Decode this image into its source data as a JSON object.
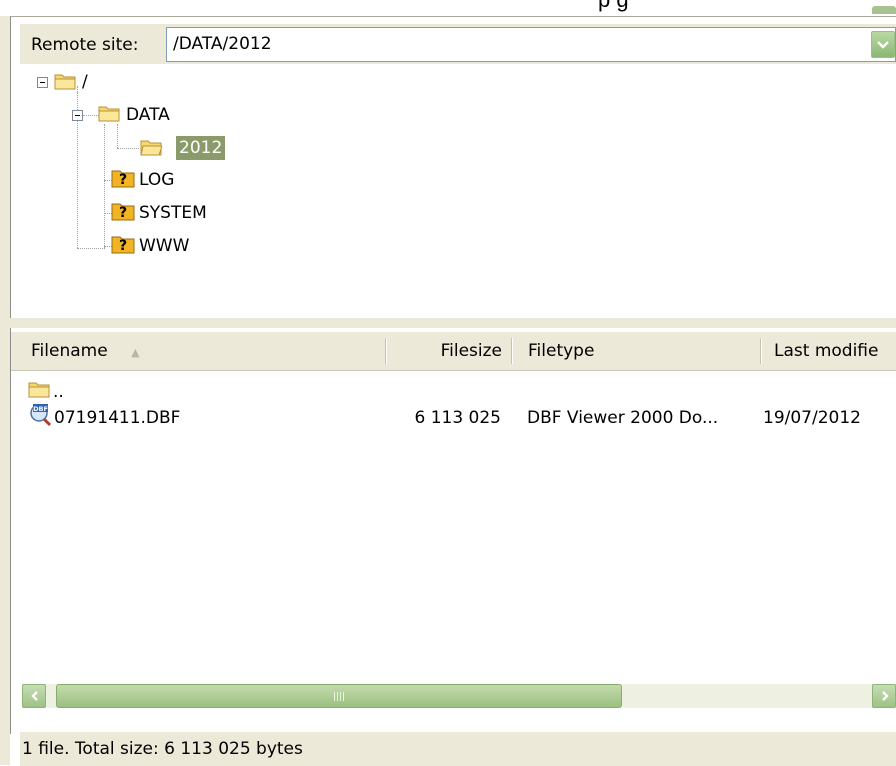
{
  "top_strip": {
    "fragment_text": "p  g"
  },
  "remote": {
    "label": "Remote site:",
    "path": "/DATA/2012",
    "tree": {
      "root": "/",
      "data": "DATA",
      "year": "2012",
      "log": "LOG",
      "system": "SYSTEM",
      "www": "WWW"
    }
  },
  "list": {
    "columns": [
      "Filename",
      "Filesize",
      "Filetype",
      "Last modifie"
    ],
    "sort_indicator": "▲",
    "rows": [
      {
        "name": "..",
        "size": "",
        "type": "",
        "modified": ""
      },
      {
        "name": "07191411.DBF",
        "size": "6 113 025",
        "type": "DBF Viewer 2000 Do...",
        "modified": "19/07/2012"
      }
    ]
  },
  "status": {
    "text": "1 file. Total size: 6 113 025 bytes"
  },
  "colors": {
    "selection": "#8a9a6a",
    "chrome": "#ece9d8",
    "scroll_accent": "#9cc285"
  },
  "icons": [
    "folder-icon",
    "question-folder-icon",
    "dbf-file-icon",
    "chevron-down-icon",
    "arrow-left-icon",
    "arrow-right-icon"
  ]
}
